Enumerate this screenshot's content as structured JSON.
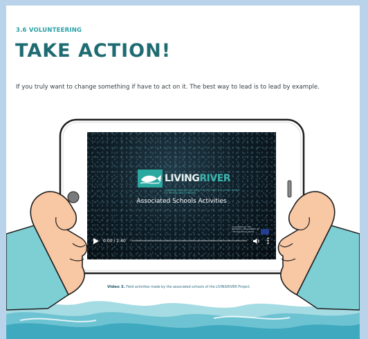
{
  "section": {
    "label": "3.6 VOLUNTEERING"
  },
  "title": "TAKE ACTION!",
  "body": {
    "paragraph": "If you truly want to change something if have to act on it. The best way to lead is to lead by example."
  },
  "video": {
    "logo_text_main": "LIVING",
    "logo_text_accent": "RIVER",
    "logo_tagline": "LEARNING AND PROTECTING THE LIFE AND THE LIVING WATER OF RIVERS AND STREAMS",
    "title": "Associated Schools Activities",
    "partner_text": "CO-FUNDED BY THE ERASMUS+ PROGRAMME OF THE EUROPEAN UNION",
    "time": "0:00 / 2:40",
    "progress": 0,
    "icons": {
      "play": "play-icon",
      "volume": "volume-icon",
      "menu": "more-vertical-icon",
      "logo": "fish-logo-icon",
      "flag": "eu-flag-icon"
    }
  },
  "caption": {
    "label": "Video 3.",
    "text": "Field activities made by the associated schools of the LIVINGRIVER Project."
  },
  "colors": {
    "page_bg": "#b9d3ea",
    "accent_teal": "#2ba0a6",
    "title_teal": "#1f6b72",
    "water_blue": "#7cc9d6",
    "skin": "#f8c7a4",
    "sleeve": "#7ecfd4"
  }
}
